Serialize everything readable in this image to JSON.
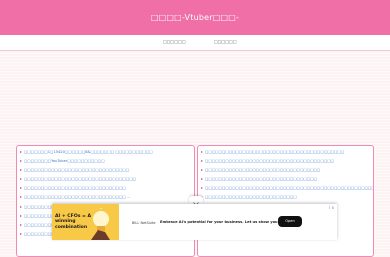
{
  "header": {
    "site_title": "□□□□-Vtuber□□□-"
  },
  "nav": {
    "items": [
      "□□□□□□",
      "□□□□□□"
    ]
  },
  "lists": {
    "left": [
      "□□□□□□□1□15420□□□□□□8&□□□□□□□ □□□□□□□□□□□",
      "□□□□□□□□YouTuber□□□□□□□□□□□",
      "□□□□□□□□□□□□□□□□□□□□□□□□□□□□□□□",
      "□□□□□□□□□□□□□□□□□□□□□□□□□□□□□□□□□",
      "□□□□□□□□□□□□□□□□□□□□□□□□□□□□□□",
      "□□□□□□□□□□□□□□□□□□□□□□□□□□□□□□ ...",
      "□□□□□□□□□□□",
      "□□□□□□□□□□□□□",
      "□□□□□□□□□□□□□□",
      "□□□□□□□□□□□□□□□□□□□□□□"
    ],
    "right": [
      "□□□□□□□□□□□□□□□□□□□□□□□□□□□□□□□□□□□□□□□□□",
      "□□□□□□□□□□□□□□□□□□□□□□□□□□□□□□□□□□□□□□",
      "□□□□□□□□□□□□□□□□□□□□□□□□□□□□□□□□□□",
      "□□□□□□□□□□□□□□□□□□□□□□□□□□□□□□□□□",
      "□□□□□□□□□□□□□□□□□□□□□□□□□□□□□□□□□□□□□□□□□□□□□□□□□□",
      "□□□□□□□□□□□□□□□□□□□□□□□□□□□"
    ]
  },
  "ad": {
    "headline": "AI + CFOs = A winning combination",
    "brand": "BILL\nNetSuite",
    "text": "Embrace AI's potential for your business. Let us show you how.",
    "cta": "Open",
    "badge": "i x",
    "colors": {
      "image_bg": "#f7c946",
      "cta_bg": "#111111"
    }
  },
  "icons": {
    "collapse": "chevron-down-icon",
    "bulb": "lightbulb-icon"
  },
  "colors": {
    "header": "#ef6fa6",
    "link": "#3a6fc6",
    "bullet": "#e4407f",
    "border": "#f08cb3"
  }
}
